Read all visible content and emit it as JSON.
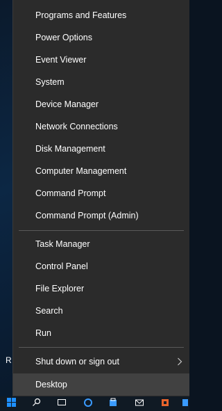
{
  "desktop": {
    "partial_label": "R"
  },
  "menu": {
    "group1": [
      "Programs and Features",
      "Power Options",
      "Event Viewer",
      "System",
      "Device Manager",
      "Network Connections",
      "Disk Management",
      "Computer Management",
      "Command Prompt",
      "Command Prompt (Admin)"
    ],
    "group2": [
      "Task Manager",
      "Control Panel",
      "File Explorer",
      "Search",
      "Run"
    ],
    "shutdown": "Shut down or sign out",
    "desktop": "Desktop"
  },
  "taskbar": {
    "icons": [
      "start-icon",
      "search-icon",
      "task-view-icon",
      "edge-icon",
      "store-icon",
      "mail-icon",
      "office-icon",
      "app-icon"
    ]
  },
  "colors": {
    "menu_bg": "#2b2b2b",
    "highlight": "#414141",
    "text": "#ffffff",
    "accent": "#0078d7"
  }
}
